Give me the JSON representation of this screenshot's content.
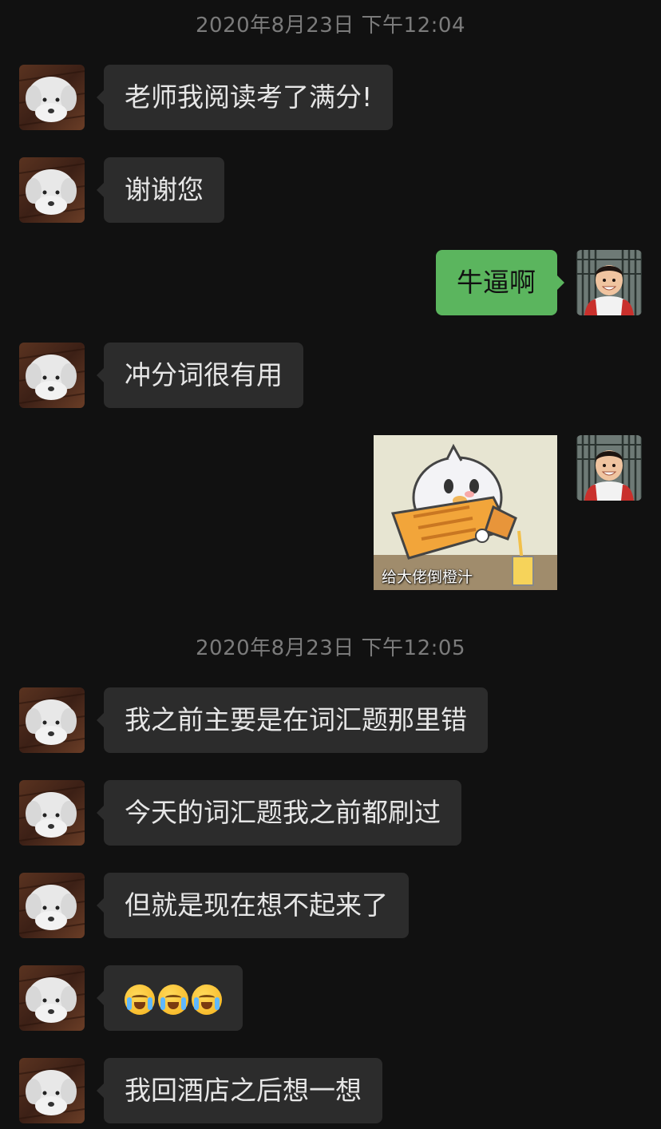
{
  "timestamps": [
    "2020年8月23日 下午12:04",
    "2020年8月23日 下午12:05"
  ],
  "messages": [
    {
      "side": "recv",
      "text": "老师我阅读考了满分!"
    },
    {
      "side": "recv",
      "text": "谢谢您"
    },
    {
      "side": "sent",
      "text": "牛逼啊"
    },
    {
      "side": "recv",
      "text": "冲分词很有用"
    },
    {
      "side": "sent",
      "type": "sticker",
      "caption": "给大佬倒橙汁"
    },
    {
      "side": "recv",
      "text": "我之前主要是在词汇题那里错"
    },
    {
      "side": "recv",
      "text": "今天的词汇题我之前都刷过"
    },
    {
      "side": "recv",
      "text": "但就是现在想不起来了"
    },
    {
      "side": "recv",
      "type": "emoji",
      "emoji": [
        "crying-face-icon",
        "crying-face-icon",
        "crying-face-icon"
      ]
    },
    {
      "side": "recv",
      "text": "我回酒店之后想一想"
    }
  ],
  "colors": {
    "background": "#111111",
    "received_bubble": "#2c2c2c",
    "sent_bubble": "#5bb55e",
    "timestamp_text": "#7b7b7b"
  }
}
